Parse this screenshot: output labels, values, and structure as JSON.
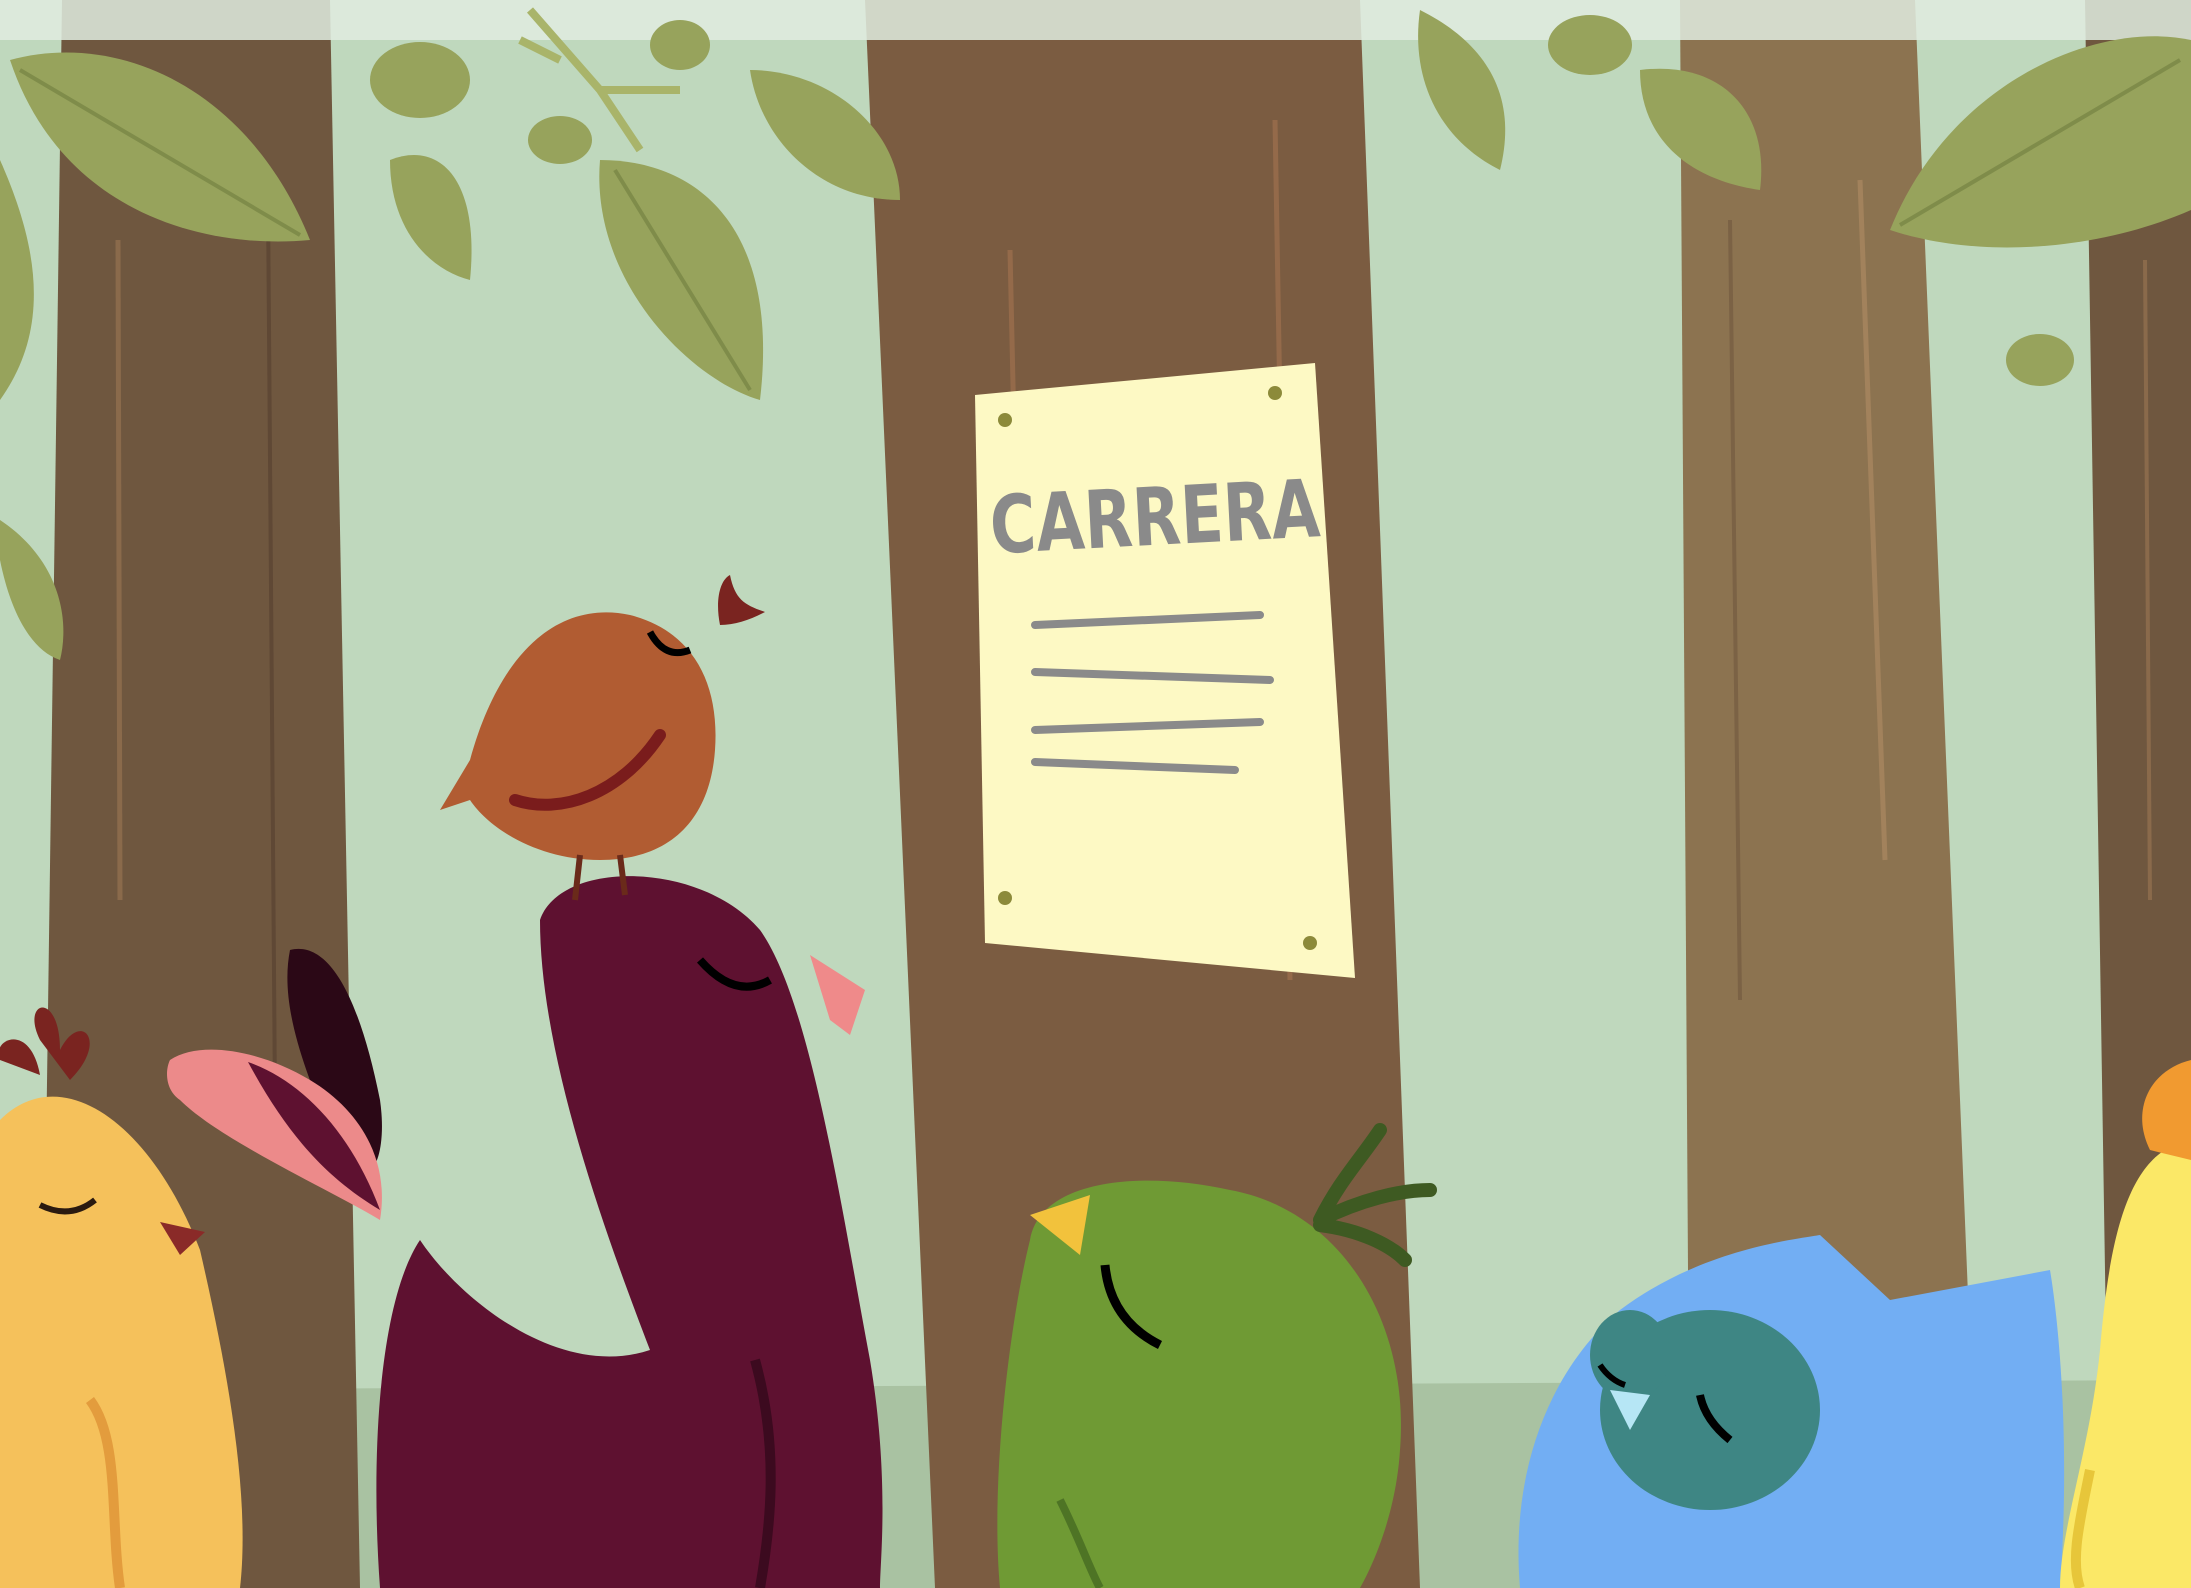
{
  "scene": {
    "poster_title": "CARRERA"
  },
  "colors": {
    "sky": "#bfd8bd",
    "trunk_dark": "#6f573f",
    "trunk_mid": "#7b5c41",
    "trunk_light": "#8c7350",
    "leaf": "#97a35c",
    "poster": "#fdf9c4",
    "poster_ink": "#888888",
    "bird_maroon": "#5e1130",
    "bird_rust": "#b15c32",
    "bird_yellow": "#f5c15b",
    "bird_green": "#6f9a34",
    "bird_blue": "#72aef3",
    "bird_lemon": "#fbe867"
  }
}
